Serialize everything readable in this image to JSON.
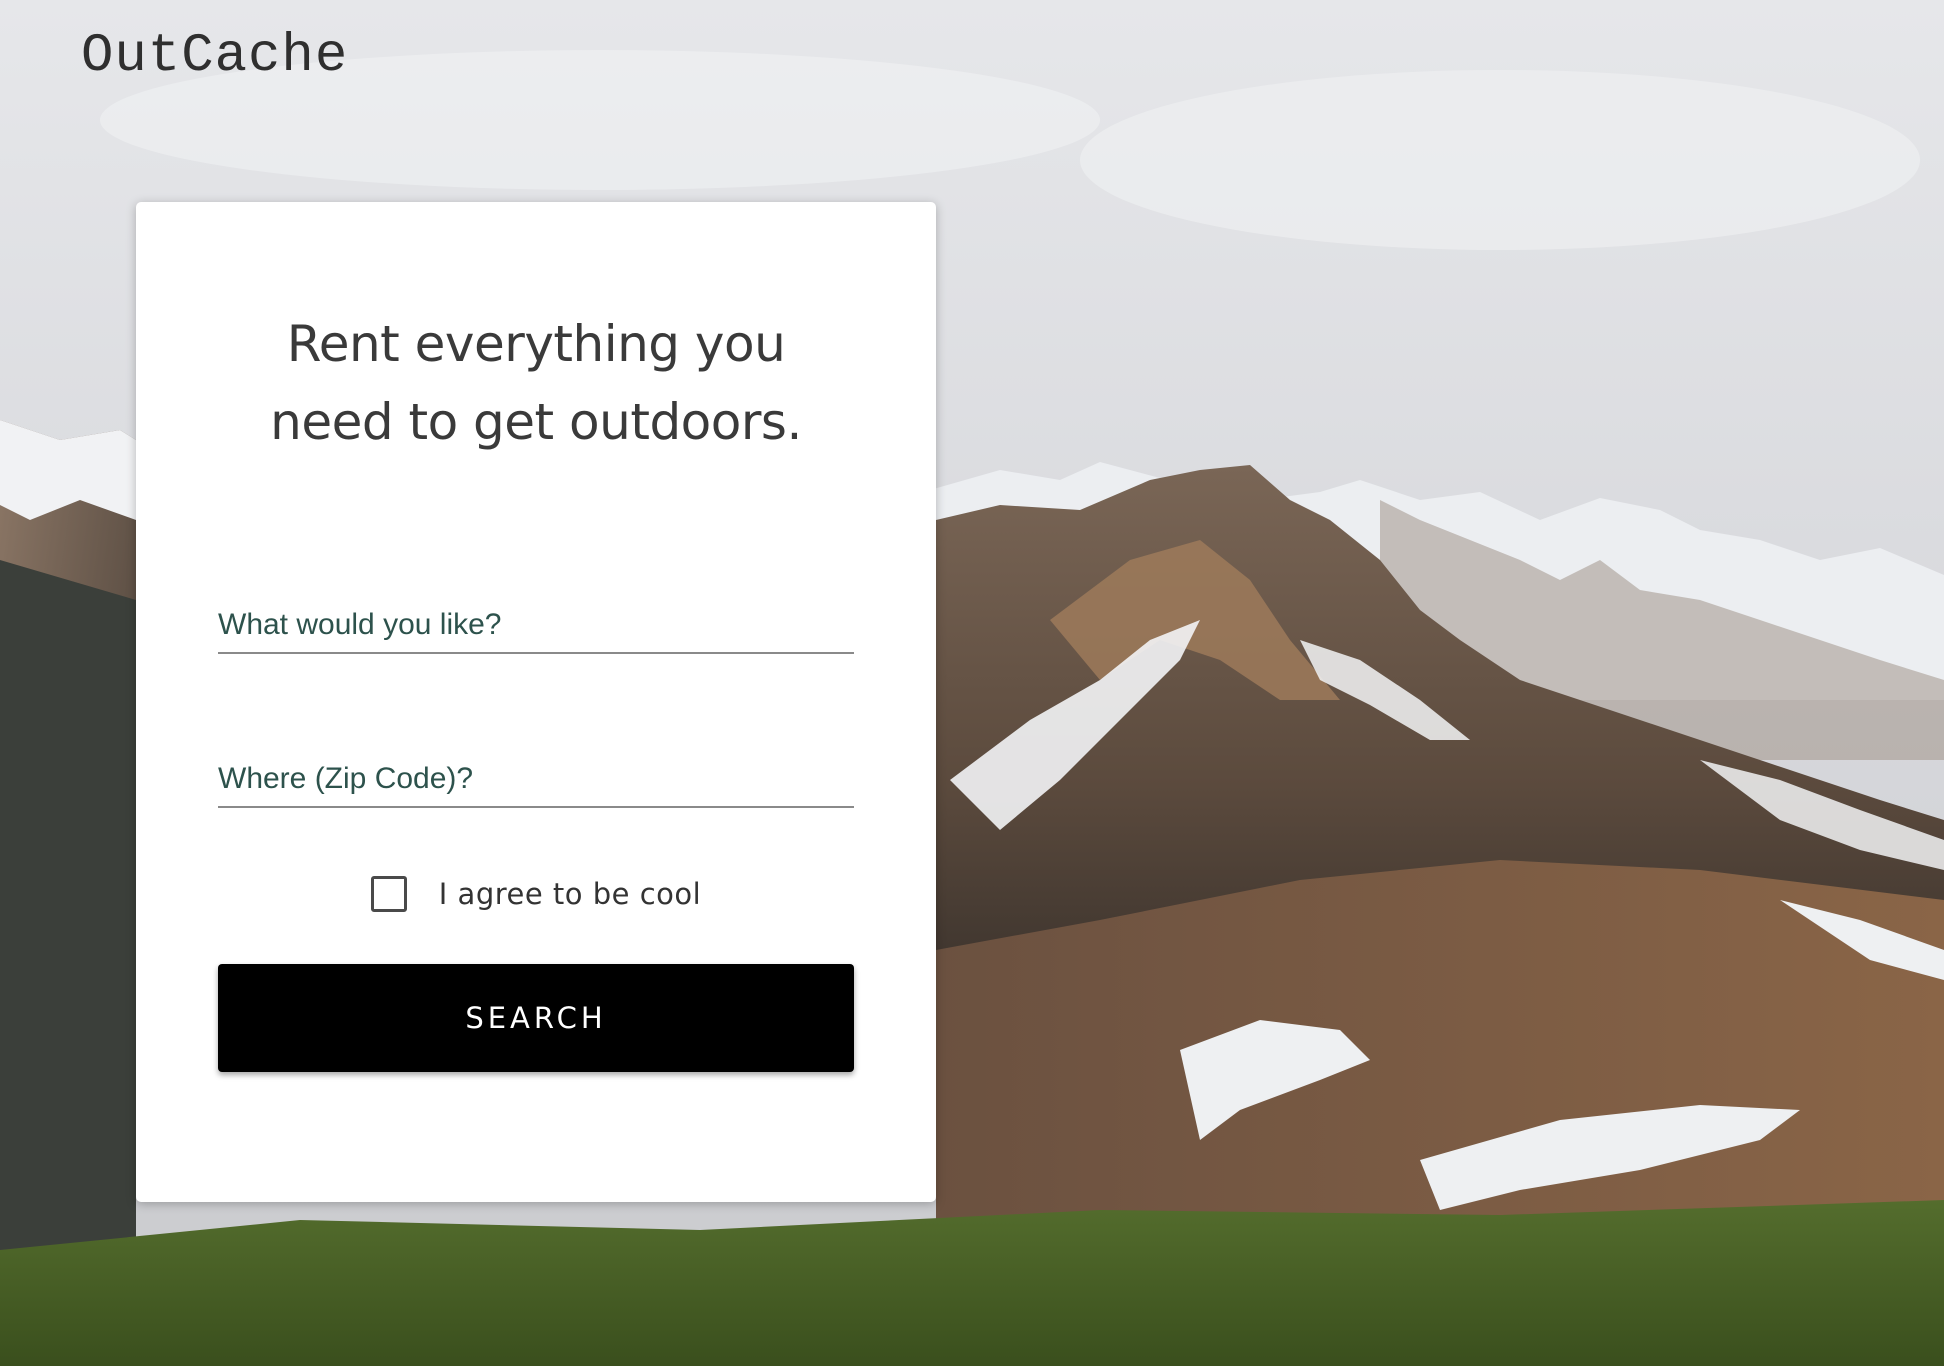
{
  "header": {
    "brand": "OutCache"
  },
  "hero": {
    "headline_line1": "Rent everything you",
    "headline_line2": "need to get outdoors."
  },
  "form": {
    "what_placeholder": "What would you like?",
    "what_value": "",
    "where_placeholder": "Where (Zip Code)?",
    "where_value": "",
    "agree_label": "I agree to be cool",
    "agree_checked": false,
    "search_label": "SEARCH"
  },
  "colors": {
    "sky": "#dcdde0",
    "rock": "#6a5446",
    "snow": "#f2f3f5",
    "grass": "#4f6b2a",
    "input_text": "#2d524c",
    "button": "#000000"
  }
}
